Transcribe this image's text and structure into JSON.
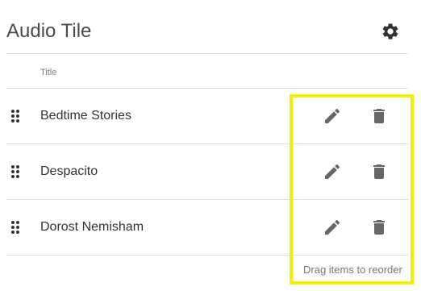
{
  "header": {
    "title": "Audio Tile",
    "settings_icon": "gear-icon"
  },
  "table": {
    "column_title": "Title",
    "rows": [
      {
        "title": "Bedtime Stories"
      },
      {
        "title": "Despacito"
      },
      {
        "title": "Dorost Nemisham"
      }
    ],
    "row_icons": {
      "drag": "drag-handle-icon",
      "edit": "pencil-icon",
      "delete": "trash-icon"
    }
  },
  "footer": {
    "hint": "Drag items to reorder"
  },
  "colors": {
    "icon": "#666666",
    "highlight": "#f0f000",
    "divider": "#e0e0e0"
  }
}
